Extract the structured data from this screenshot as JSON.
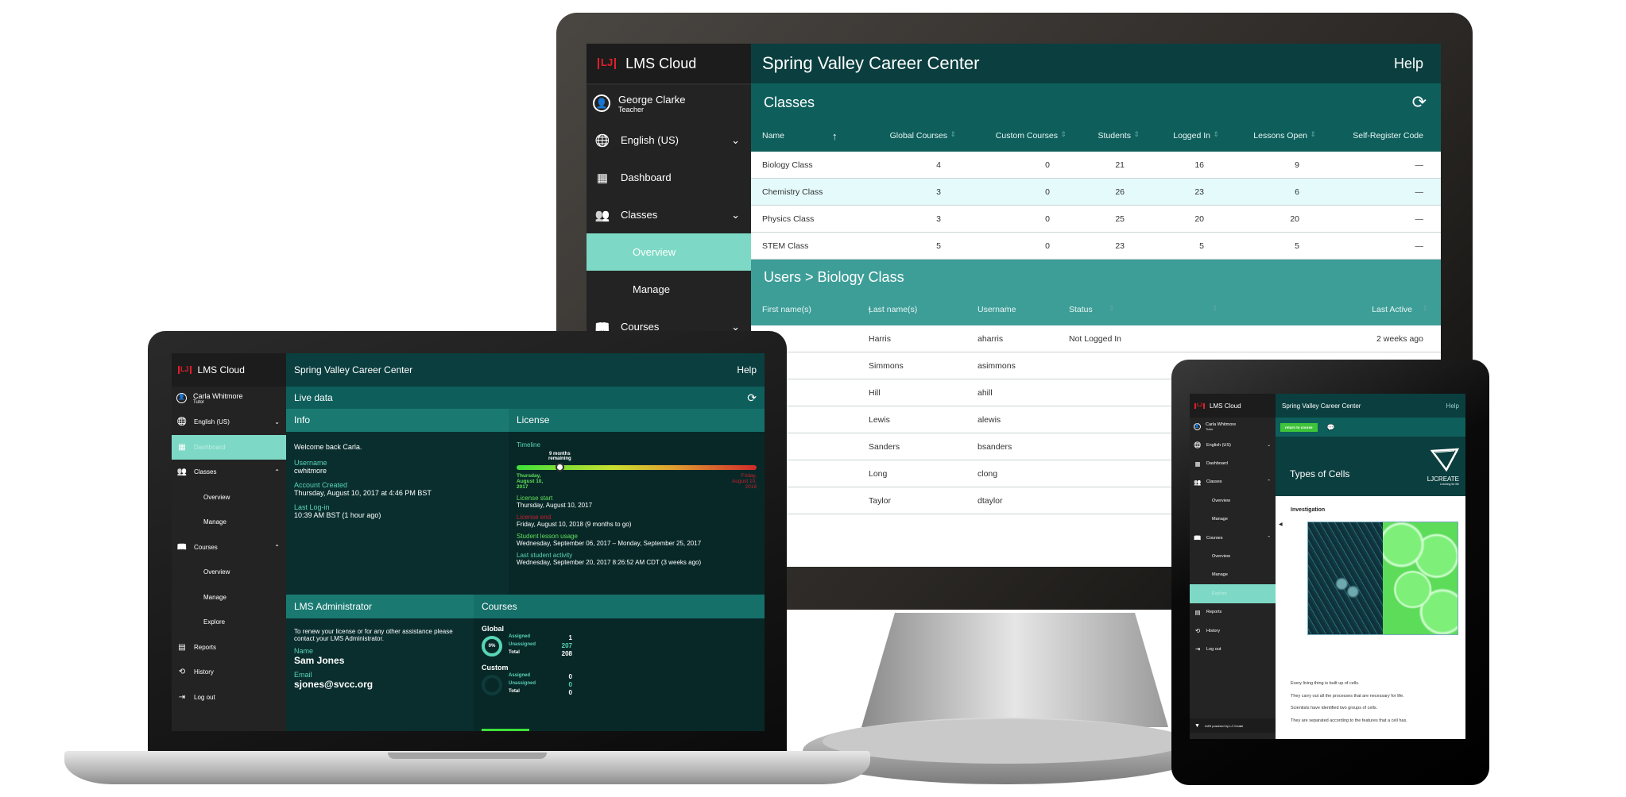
{
  "colors": {
    "accent": "#7dd9c5",
    "header": "#0b3e3f",
    "band": "#0e5f5c",
    "users_band": "#3d9e98",
    "logo_red": "#e0202a"
  },
  "monitor": {
    "app": "LMS Cloud",
    "logo_mark": "LJ",
    "user": {
      "name": "George Clarke",
      "role": "Teacher"
    },
    "nav": [
      {
        "label": "English (US)",
        "icon": "globe-icon",
        "chevron": "chevron-down"
      },
      {
        "label": "Dashboard",
        "icon": "dashboard-icon"
      },
      {
        "label": "Classes",
        "icon": "users-icon",
        "chevron": "chevron-down"
      },
      {
        "label": "Overview",
        "sub": true,
        "active": true
      },
      {
        "label": "Manage",
        "sub": true
      },
      {
        "label": "Courses",
        "icon": "book-icon",
        "chevron": "chevron-down"
      }
    ],
    "title": "Spring Valley Career Center",
    "help": "Help",
    "classes": {
      "title": "Classes",
      "columns": [
        "Name",
        "Global Courses",
        "Custom Courses",
        "Students",
        "Logged In",
        "Lessons Open",
        "Self-Register Code"
      ],
      "rows": [
        [
          "Biology Class",
          "4",
          "0",
          "21",
          "16",
          "9",
          "—"
        ],
        [
          "Chemistry Class",
          "3",
          "0",
          "26",
          "23",
          "6",
          "—"
        ],
        [
          "Physics Class",
          "3",
          "0",
          "25",
          "20",
          "20",
          "—"
        ],
        [
          "STEM Class",
          "5",
          "0",
          "23",
          "5",
          "5",
          "—"
        ]
      ]
    },
    "users": {
      "title": "Users > Biology Class",
      "columns": [
        "First name(s)",
        "Last name(s)",
        "Username",
        "Status",
        "Last Active"
      ],
      "rows": [
        [
          "",
          "Harris",
          "aharris",
          "Not Logged In",
          "2 weeks ago"
        ],
        [
          "",
          "Simmons",
          "asimmons",
          "",
          ""
        ],
        [
          "",
          "Hill",
          "ahill",
          "",
          ""
        ],
        [
          "",
          "Lewis",
          "alewis",
          "",
          ""
        ],
        [
          "",
          "Sanders",
          "bsanders",
          "",
          ""
        ],
        [
          "",
          "Long",
          "clong",
          "",
          ""
        ],
        [
          "",
          "Taylor",
          "dtaylor",
          "",
          ""
        ]
      ]
    }
  },
  "laptop": {
    "app": "LMS Cloud",
    "logo_mark": "LJ",
    "user": {
      "name": "Carla Whitmore",
      "role": "Tutor"
    },
    "nav": [
      {
        "label": "English (US)",
        "icon": "globe-icon",
        "chevron": "chevron-down"
      },
      {
        "label": "Dashboard",
        "icon": "dashboard-icon",
        "active": true
      },
      {
        "label": "Classes",
        "icon": "users-icon",
        "chevron": "chevron-up"
      },
      {
        "label": "Overview",
        "sub": true
      },
      {
        "label": "Manage",
        "sub": true
      },
      {
        "label": "Courses",
        "icon": "book-icon",
        "chevron": "chevron-up"
      },
      {
        "label": "Overview",
        "sub": true
      },
      {
        "label": "Manage",
        "sub": true
      },
      {
        "label": "Explore",
        "sub": true
      },
      {
        "label": "Reports",
        "icon": "reports-icon"
      },
      {
        "label": "History",
        "icon": "history-icon"
      },
      {
        "label": "Log out",
        "icon": "logout-icon"
      }
    ],
    "title": "Spring Valley Career Center",
    "help": "Help",
    "live_data": "Live data",
    "info": {
      "title": "Info",
      "welcome": "Welcome back Carla.",
      "fields": [
        {
          "label": "Username",
          "value": "cwhitmore"
        },
        {
          "label": "Account Created",
          "value": "Thursday, August 10, 2017 at 4:46 PM BST"
        },
        {
          "label": "Last Log-in",
          "value": "10:39 AM BST (1 hour ago)"
        }
      ]
    },
    "license": {
      "title": "License",
      "timeline_label": "Timeline",
      "remaining": "9 months remaining",
      "progress": 0.18,
      "start_date": "Thursday, August 10, 2017",
      "end_date": "Friday, August 10, 2018",
      "fields": [
        {
          "label": "License start",
          "value": "Thursday, August 10, 2017",
          "color": "#5fe05a"
        },
        {
          "label": "License end",
          "value": "Friday, August 10, 2018 (9 months to go)",
          "color": "#c8202a"
        },
        {
          "label": "Student lesson usage",
          "value": "Wednesday, September 06, 2017 – Monday, September 25, 2017",
          "color": "#5fe05a"
        },
        {
          "label": "Last student activity",
          "value": "Wednesday, September 20, 2017 8:26:52 AM CDT (3 weeks ago)",
          "color": "#58d6b5"
        }
      ]
    },
    "admin": {
      "title": "LMS Administrator",
      "text": "To renew your license or for any other assistance please contact your LMS Administrator.",
      "name_label": "Name",
      "name": "Sam Jones",
      "email_label": "Email",
      "email": "sjones@svcc.org"
    },
    "courses": {
      "title": "Courses",
      "groups": [
        {
          "name": "Global",
          "percent": "0%",
          "assigned": "1",
          "unassigned": "207",
          "total": "208"
        },
        {
          "name": "Custom",
          "percent": "",
          "assigned": "0",
          "unassigned": "0",
          "total": "0"
        }
      ],
      "assigned_label": "Assigned",
      "unassigned_label": "Unassigned",
      "total_label": "Total"
    }
  },
  "tablet": {
    "app": "LMS Cloud",
    "logo_mark": "LJ",
    "user": {
      "name": "Carla Whitmore",
      "role": "Tutor"
    },
    "nav": [
      {
        "label": "English (US)",
        "icon": "globe-icon",
        "chevron": "chevron-down"
      },
      {
        "label": "Dashboard",
        "icon": "dashboard-icon"
      },
      {
        "label": "Classes",
        "icon": "users-icon",
        "chevron": "chevron-up"
      },
      {
        "label": "Overview",
        "sub": true
      },
      {
        "label": "Manage",
        "sub": true
      },
      {
        "label": "Courses",
        "icon": "book-icon",
        "chevron": "chevron-up"
      },
      {
        "label": "Overview",
        "sub": true
      },
      {
        "label": "Manage",
        "sub": true
      },
      {
        "label": "Explore",
        "sub": true,
        "active": true
      },
      {
        "label": "Reports",
        "icon": "reports-icon"
      },
      {
        "label": "History",
        "icon": "history-icon"
      },
      {
        "label": "Log out",
        "icon": "logout-icon"
      }
    ],
    "footer": "LMS powered by LJ Create",
    "title": "Spring Valley Career Center",
    "help": "Help",
    "return_button": "return to course",
    "lesson_title": "Types of Cells",
    "brand": "LJCREATE",
    "brand_tagline": "Learning for life",
    "section": "Investigation",
    "paragraphs": [
      "Every living thing is built up of cells.",
      "They carry out all the processes that are necessary for life.",
      "Scientists have identified two groups of cells.",
      "They are separated according to the features that a cell has."
    ]
  }
}
